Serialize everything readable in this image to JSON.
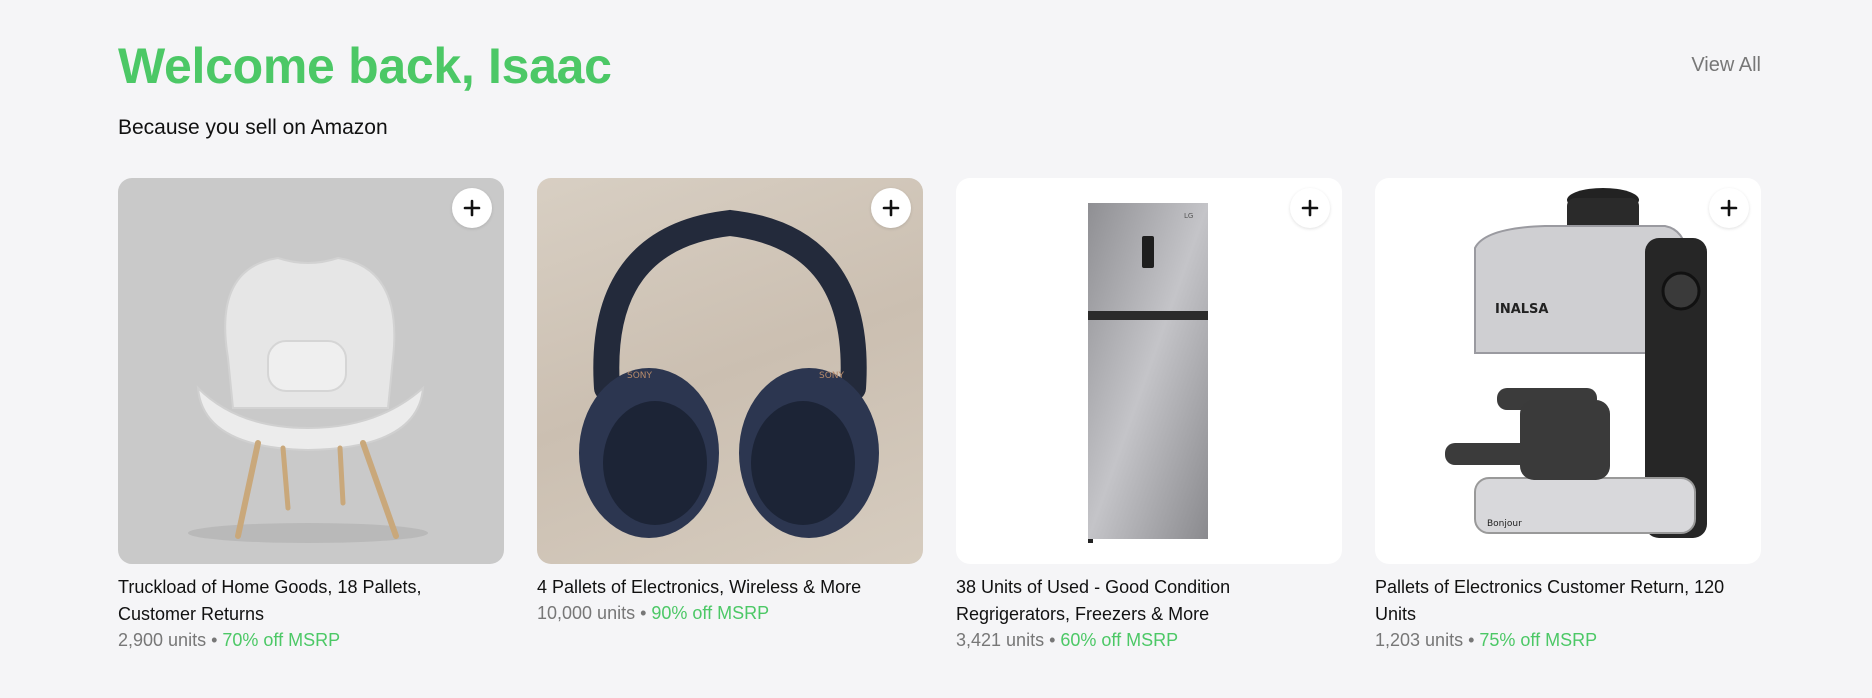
{
  "header": {
    "title": "Welcome back, Isaac",
    "view_all": "View All"
  },
  "subtitle": "Because you sell on Amazon",
  "cards": [
    {
      "title": "Truckload of Home Goods, 18 Pallets, Customer Returns",
      "units": "2,900 units",
      "separator": " • ",
      "discount": "70% off MSRP",
      "image": "armchair-image"
    },
    {
      "title": "4 Pallets of Electronics, Wireless & More",
      "units": "10,000 units",
      "separator": " • ",
      "discount": "90% off MSRP",
      "image": "headphones-image"
    },
    {
      "title": "38 Units of Used - Good Condition Regrigerators, Freezers & More",
      "units": "3,421 units",
      "separator": " • ",
      "discount": "60% off MSRP",
      "image": "refrigerator-image"
    },
    {
      "title": "Pallets of Electronics Customer Return, 120 Units",
      "units": "1,203 units",
      "separator": " • ",
      "discount": "75% off MSRP",
      "image": "espresso-machine-image"
    }
  ],
  "colors": {
    "accent": "#4cc866",
    "background": "#f5f5f7",
    "muted": "#777777"
  },
  "icons": {
    "add": "plus-icon"
  },
  "image_text": {
    "brand_headphones": "SONY",
    "brand_espresso": "INALSA",
    "brand_espresso_sub": "Bonjour",
    "brand_fridge": "LG"
  }
}
